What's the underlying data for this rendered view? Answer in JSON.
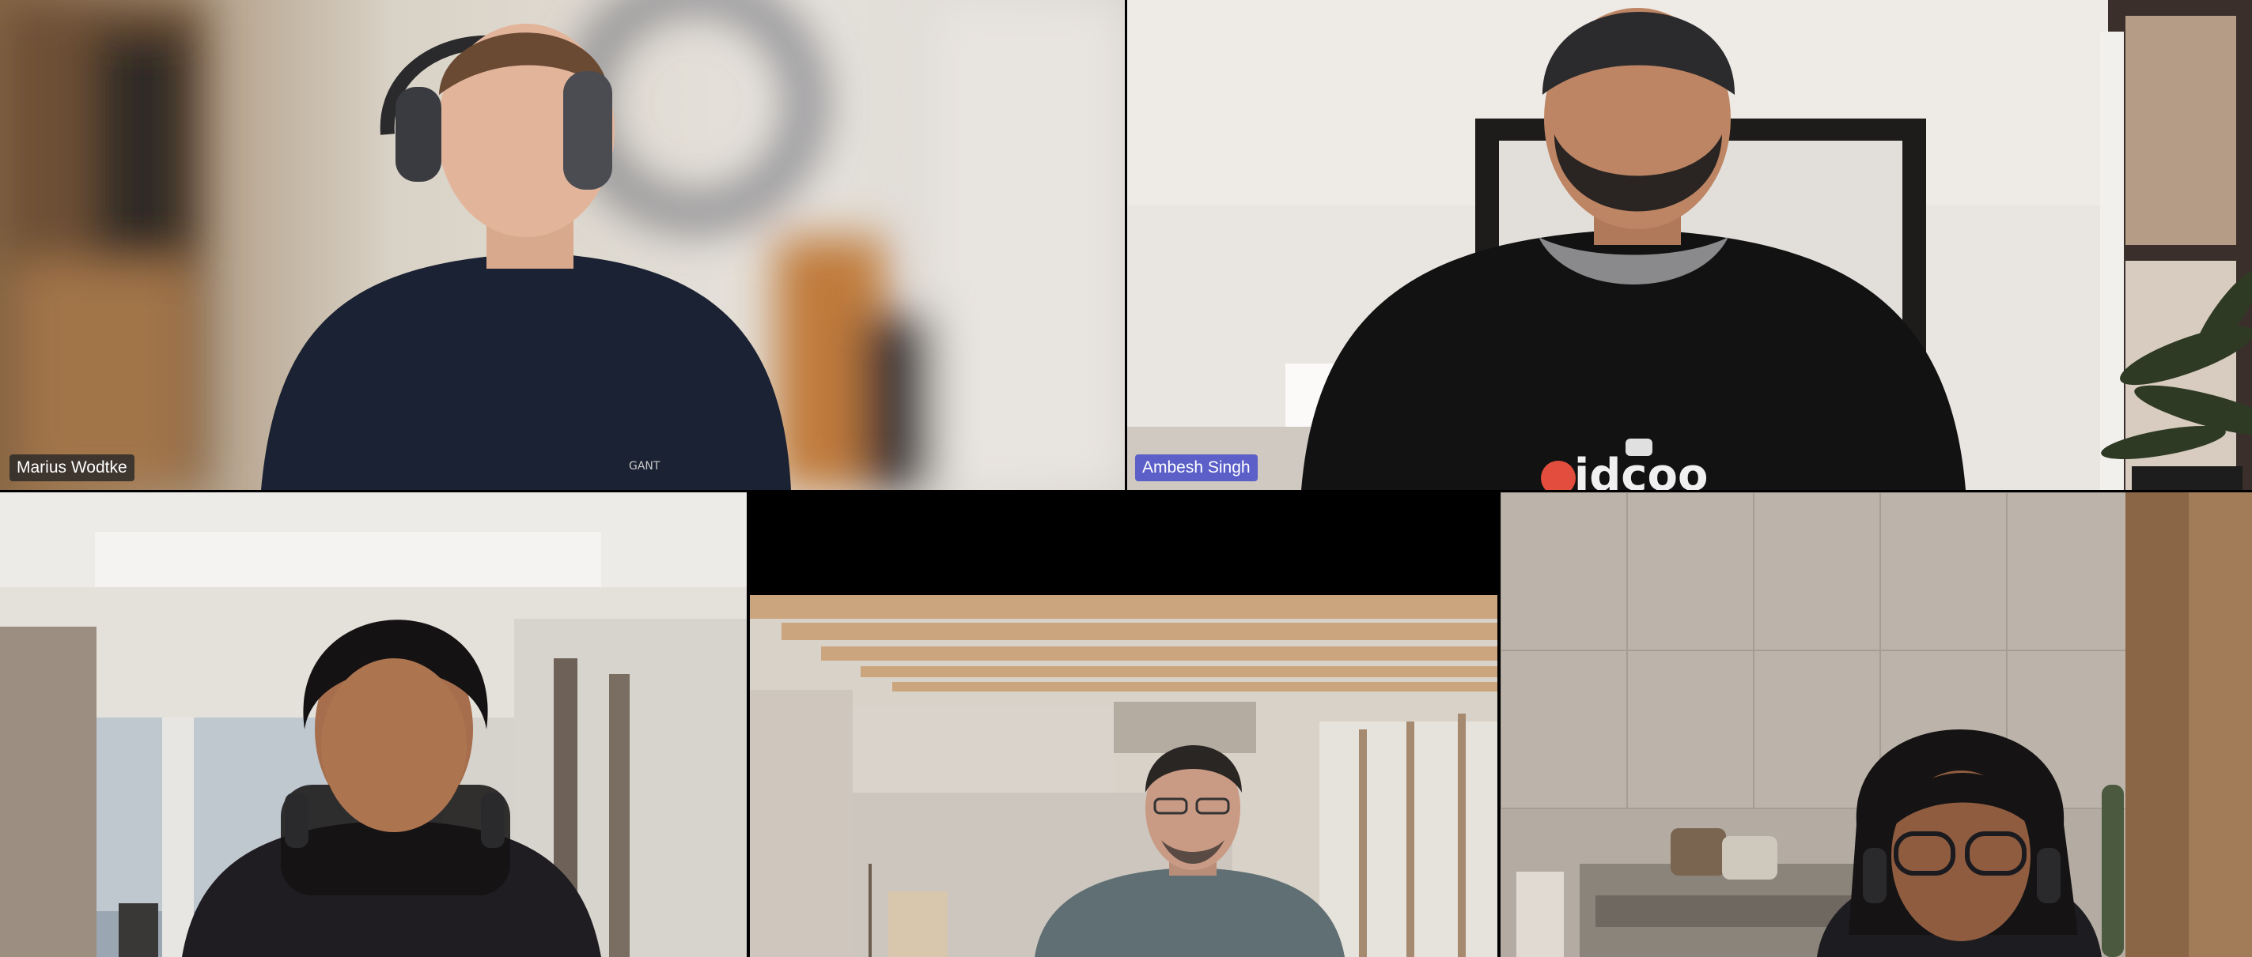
{
  "participants": [
    {
      "name": "Marius Wodtke",
      "speaking": false
    },
    {
      "name": "Ambesh Singh",
      "speaking": true
    },
    {
      "name": "",
      "speaking": false
    },
    {
      "name": "",
      "speaking": false
    },
    {
      "name": "",
      "speaking": false
    }
  ],
  "colors": {
    "active_speaker_tag": "#5b5fc7",
    "name_tag": "#282828",
    "grid_background": "#000000"
  }
}
